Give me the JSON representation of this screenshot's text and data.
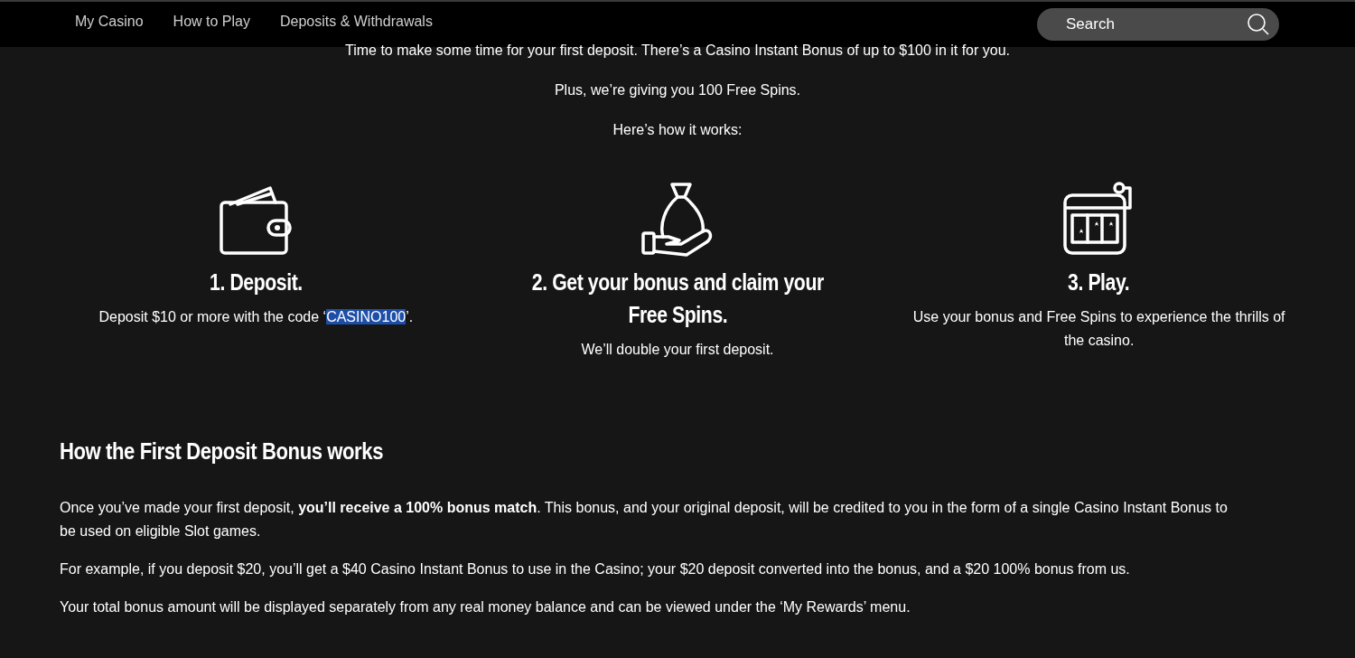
{
  "nav": {
    "links": [
      {
        "label": "My Casino"
      },
      {
        "label": "How to Play"
      },
      {
        "label": "Deposits & Withdrawals"
      }
    ],
    "search": {
      "placeholder": "Search"
    }
  },
  "intro": [
    "Time to make some time for your first deposit. There’s a Casino Instant Bonus of up to $100 in it for you.",
    "Plus, we’re giving you 100 Free Spins.",
    "Here’s how it works:"
  ],
  "steps": [
    {
      "kind": "wallet",
      "title": "1. Deposit.",
      "text": "Deposit $10 or more with the code ‘",
      "code": "CASINO100",
      "code_selected": true,
      "text_after": "’."
    },
    {
      "kind": "bag",
      "title": "2. Get your bonus and claim your Free Spins.",
      "text": "We’ll double your first deposit."
    },
    {
      "kind": "slot",
      "title": "3. Play.",
      "text": "Use your bonus and Free Spins to experience the thrills of the casino."
    }
  ],
  "section": {
    "title": "How the First Deposit Bonus works",
    "paragraphs": [
      "Once you’ve made your first deposit, **you’ll receive a 100% bonus match**. This bonus, and your original deposit, will be credited to you in the form of a single Casino Instant Bonus to be used on eligible Slot games.",
      "For example, if you deposit $20, you’ll get a $40 Casino Instant Bonus to use in the Casino; your $20 deposit converted into the bonus, and a $20 100% bonus from us.",
      "Your total bonus amount will be displayed separately from any real money balance and can be viewed under the ‘My Rewards’ menu."
    ]
  }
}
